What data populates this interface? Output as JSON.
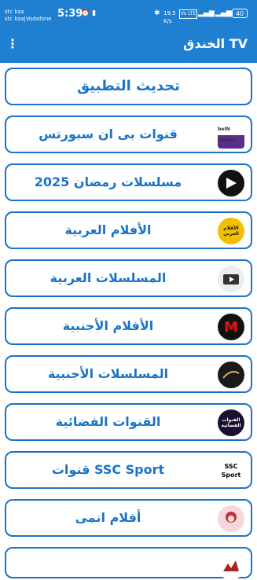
{
  "status": {
    "carrier1": "stc ksa",
    "carrier2": "stc ksa|Vodafone",
    "time": "5:39",
    "net_speed": "19.5 K/s",
    "battery": "40",
    "volte": "Vo LTE"
  },
  "app": {
    "title": "الخندق TV",
    "menu_icon": "more-vert-icon"
  },
  "update_label": "تحديث التطبيق",
  "items": [
    {
      "label": "قنوات بى ان سبورتس",
      "logo_text": "beIN Sports"
    },
    {
      "label": "مسلسلات رمضان 2025",
      "logo_text": ""
    },
    {
      "label": "الأفلام العربية",
      "logo_text": "الأفلام العربي"
    },
    {
      "label": "المسلسلات العربية",
      "logo_text": ""
    },
    {
      "label": "الأفلام الأجنبية",
      "logo_text": "M"
    },
    {
      "label": "المسلسلات الأجنبية",
      "logo_text": ""
    },
    {
      "label": "القنوات الفضائية",
      "logo_text": "القنوات الفضائية"
    },
    {
      "label": "قنوات SSC Sport",
      "logo_text": "SSC Sport"
    },
    {
      "label": "أفلام انمى",
      "logo_text": ""
    }
  ],
  "colors": {
    "accent": "#1f7fd0",
    "border": "#1a73c8"
  }
}
